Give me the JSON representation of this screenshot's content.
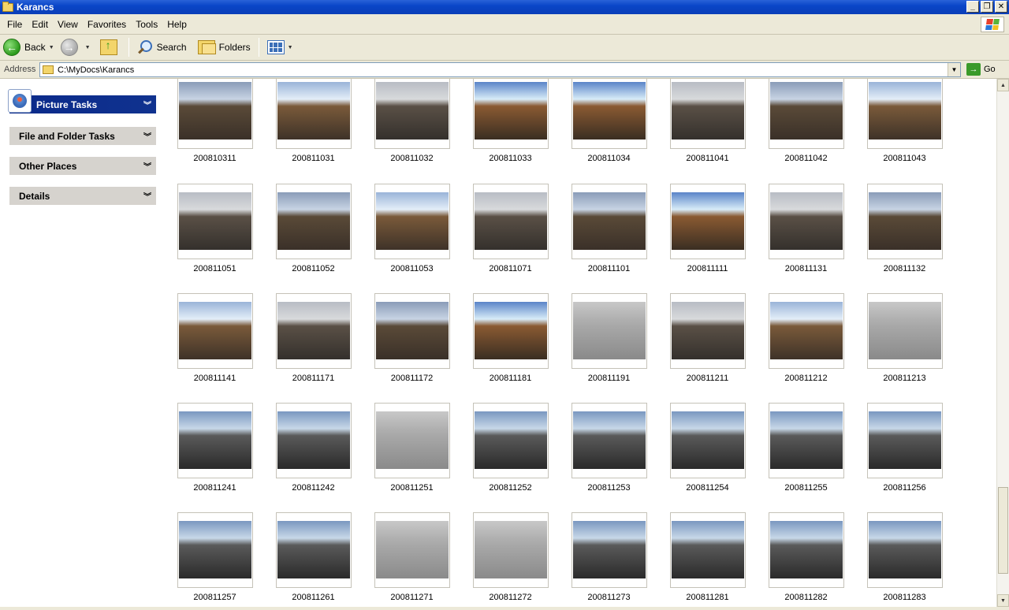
{
  "window": {
    "title": "Karancs"
  },
  "menu": [
    "File",
    "Edit",
    "View",
    "Favorites",
    "Tools",
    "Help"
  ],
  "toolbar": {
    "back_label": "Back",
    "search_label": "Search",
    "folders_label": "Folders"
  },
  "address": {
    "label": "Address",
    "path": "C:\\MyDocs\\Karancs",
    "go_label": "Go"
  },
  "tasks": [
    {
      "label": "Picture Tasks",
      "primary": true
    },
    {
      "label": "File and Folder Tasks",
      "primary": false
    },
    {
      "label": "Other Places",
      "primary": false
    },
    {
      "label": "Details",
      "primary": false
    }
  ],
  "files": [
    "200810311",
    "200811031",
    "200811032",
    "200811033",
    "200811034",
    "200811041",
    "200811042",
    "200811043",
    "200811051",
    "200811052",
    "200811053",
    "200811071",
    "200811101",
    "200811111",
    "200811131",
    "200811132",
    "200811141",
    "200811171",
    "200811172",
    "200811181",
    "200811191",
    "200811211",
    "200811212",
    "200811213",
    "200811241",
    "200811242",
    "200811251",
    "200811252",
    "200811253",
    "200811254",
    "200811255",
    "200811256",
    "200811257",
    "200811261",
    "200811271",
    "200811272",
    "200811273",
    "200811281",
    "200811282",
    "200811283"
  ]
}
